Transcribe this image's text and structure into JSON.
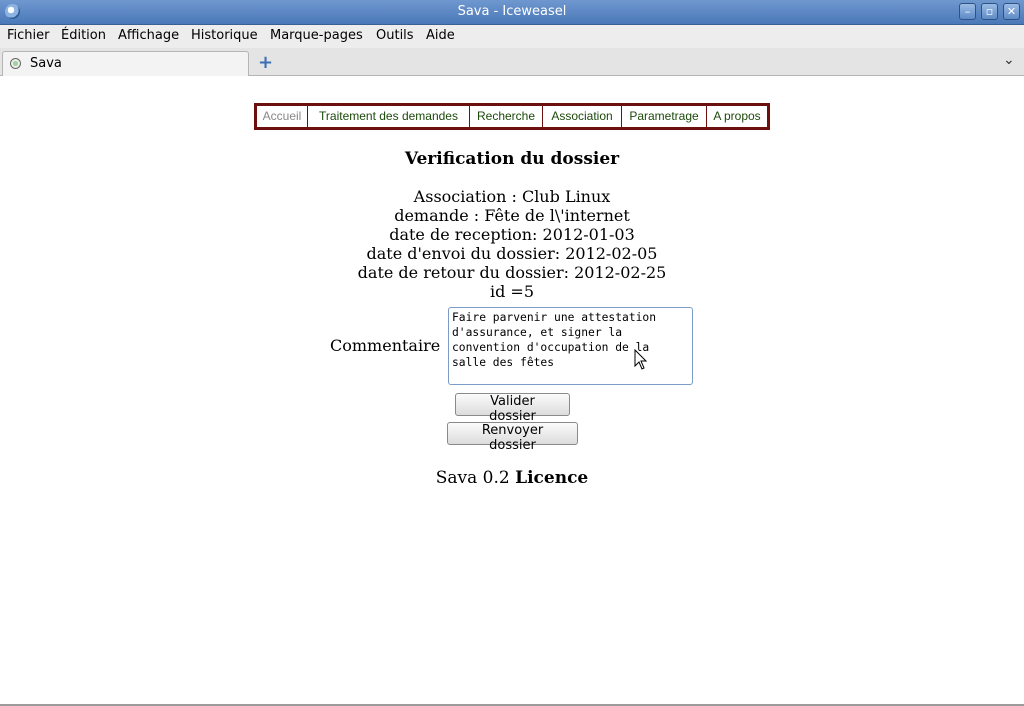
{
  "window": {
    "title": "Sava - Iceweasel",
    "buttons": [
      "minimize",
      "maximize",
      "close"
    ]
  },
  "menu": [
    "Fichier",
    "Édition",
    "Affichage",
    "Historique",
    "Marque-pages",
    "Outils",
    "Aide"
  ],
  "tab": {
    "label": "Sava",
    "new_tab_glyph": "+",
    "list_glyph": "⌄"
  },
  "nav": [
    "Accueil",
    "Traitement des demandes",
    "Recherche",
    "Association",
    "Parametrage",
    "A propos"
  ],
  "page": {
    "title": "Verification du dossier",
    "association": "Association : Club Linux",
    "demande": "demande : Fête de l\\'internet",
    "reception": "date de reception: 2012-01-03",
    "envoi": "date d'envoi du dossier: 2012-02-05",
    "retour": "date de retour du dossier: 2012-02-25",
    "id": "id =5",
    "comment_label": "Commentaire",
    "comment_value": "Faire parvenir une attestation d'assurance, et signer la convention d'occupation de la salle des fêtes",
    "validate_button": "Valider dossier",
    "return_button": "Renvoyer dossier"
  },
  "footer": {
    "version": "Sava 0.2",
    "licence": "Licence"
  },
  "colors": {
    "nav_border": "#6b0f0f",
    "nav_link": "#1c4a0c",
    "titlebar": "#5b86c2"
  }
}
